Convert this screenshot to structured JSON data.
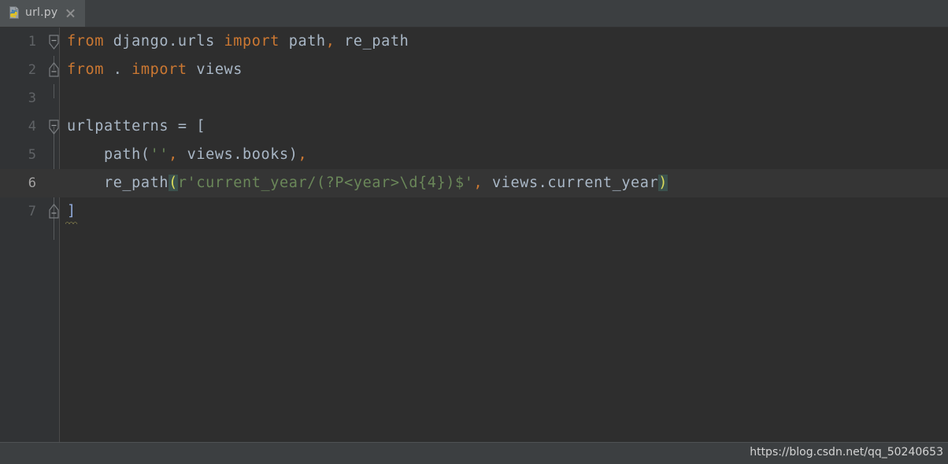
{
  "tab": {
    "label": "url.py",
    "icon": "python-file-icon",
    "close_icon": "close-icon"
  },
  "editor": {
    "language": "python",
    "current_line": 6,
    "colors": {
      "background": "#2E2E2E",
      "gutter": "#313335",
      "current_line": "#353535",
      "keyword": "#CC7832",
      "plain": "#A9B7C6",
      "string": "#6A8759",
      "line_number": "#606366",
      "paren_match_fg": "#DCDC5A",
      "paren_match_bg": "#3B514D",
      "bracket_blue": "#8FA8D8",
      "warning_underline": "#A9A05A"
    },
    "lines": [
      {
        "num": "1",
        "fold": "collapse-down",
        "text": "from django.urls import path, re_path"
      },
      {
        "num": "2",
        "fold": "collapse-up",
        "text": "from . import views"
      },
      {
        "num": "3",
        "fold": "none",
        "text": ""
      },
      {
        "num": "4",
        "fold": "collapse-down",
        "text": "urlpatterns = ["
      },
      {
        "num": "5",
        "fold": "none",
        "text": "    path('', views.books),"
      },
      {
        "num": "6",
        "fold": "none",
        "text": "    re_path(r'current_year/(?P<year>\\d{4})$', views.current_year)"
      },
      {
        "num": "7",
        "fold": "collapse-up",
        "text": "]"
      }
    ],
    "tokens": {
      "l1_kw_from": "from",
      "l1_mod": " django.urls ",
      "l1_kw_import": "import",
      "l1_names": " path",
      "l1_comma": ",",
      "l1_names2": " re_path",
      "l2_kw_from": "from",
      "l2_dot": " . ",
      "l2_kw_import": "import",
      "l2_names": " views",
      "l4_name": "urlpatterns = [",
      "l5_indent": "    path(",
      "l5_str": "''",
      "l5_comma": ",",
      "l5_rest": " views.books)",
      "l5_comma2": ",",
      "l6_indent": "    re_path",
      "l6_paren_open": "(",
      "l6_str": "r'current_year/(?P<year>\\d{4})$'",
      "l6_comma": ",",
      "l6_rest": " views.current_year",
      "l6_paren_close": ")",
      "l7_bracket": "]"
    }
  },
  "watermark": {
    "text": "https://blog.csdn.net/qq_50240653"
  }
}
